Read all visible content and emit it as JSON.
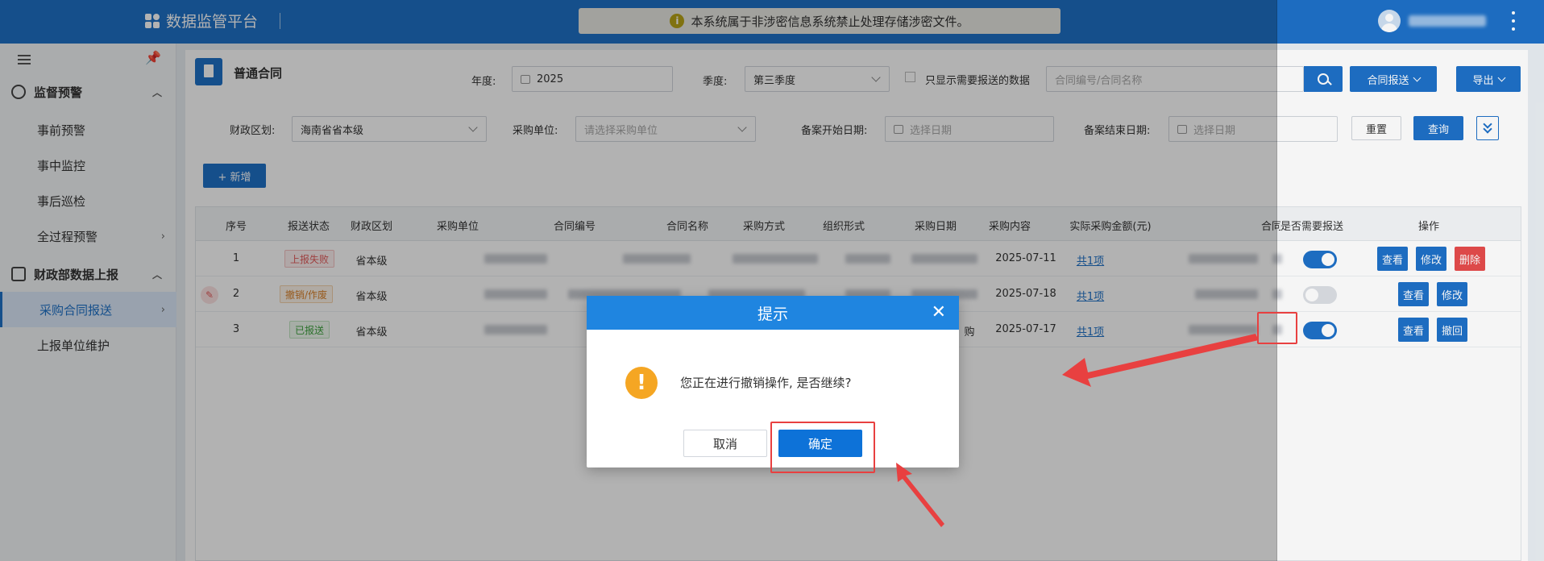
{
  "header": {
    "app_title": "数据监管平台",
    "notice": "本系统属于非涉密信息系统禁止处理存储涉密文件。",
    "notice_icon": "i"
  },
  "sidebar": {
    "groups": [
      {
        "label": "监督预警",
        "icon": "radar-icon"
      },
      {
        "label": "财政部数据上报",
        "icon": "chart-icon"
      }
    ],
    "items": [
      {
        "label": "事前预警"
      },
      {
        "label": "事中监控"
      },
      {
        "label": "事后巡检"
      },
      {
        "label": "全过程预警"
      },
      {
        "label": "采购合同报送",
        "active": true
      },
      {
        "label": "上报单位维护"
      }
    ]
  },
  "content": {
    "title": "普通合同",
    "filters": {
      "year_label": "年度:",
      "year_value": "2025",
      "season_label": "季度:",
      "season_value": "第三季度",
      "only_need_label": "只显示需要报送的数据",
      "search_placeholder": "合同编号/合同名称",
      "report_btn": "合同报送",
      "export_btn": "导出",
      "region_label": "财政区划:",
      "region_value": "海南省省本级",
      "unit_label": "采购单位:",
      "unit_placeholder": "请选择采购单位",
      "start_label": "备案开始日期:",
      "start_placeholder": "选择日期",
      "end_label": "备案结束日期:",
      "end_placeholder": "选择日期",
      "reset_btn": "重置",
      "query_btn": "查询"
    },
    "add_btn": "+ 新增",
    "table": {
      "headers": [
        "序号",
        "报送状态",
        "财政区划",
        "采购单位",
        "合同编号",
        "合同名称",
        "采购方式",
        "组织形式",
        "采购日期",
        "采购内容",
        "实际采购金额(元)",
        "合同类型",
        "是否需要报送",
        "操作"
      ],
      "rows": [
        {
          "no": "1",
          "status": "上报失败",
          "region": "省本级",
          "date": "2025-07-11",
          "content": "共1项",
          "actions": [
            "查看",
            "修改",
            "删除"
          ]
        },
        {
          "no": "2",
          "status": "撤销/作废",
          "region": "省本级",
          "date": "2025-07-18",
          "content": "共1项",
          "actions": [
            "查看",
            "修改"
          ]
        },
        {
          "no": "3",
          "status": "已报送",
          "region": "省本级",
          "org_suffix": "购",
          "date": "2025-07-17",
          "content": "共1项",
          "actions": [
            "查看",
            "撤回"
          ]
        }
      ]
    }
  },
  "dialog": {
    "title": "提示",
    "close": "✕",
    "icon": "!",
    "message": "您正在进行撤销操作, 是否继续?",
    "cancel": "取消",
    "confirm": "确定"
  },
  "colors": {
    "primary": "#1f71c8",
    "dialog_header": "#1f85e0",
    "warning": "#f5a623",
    "annotation": "#e84040"
  }
}
